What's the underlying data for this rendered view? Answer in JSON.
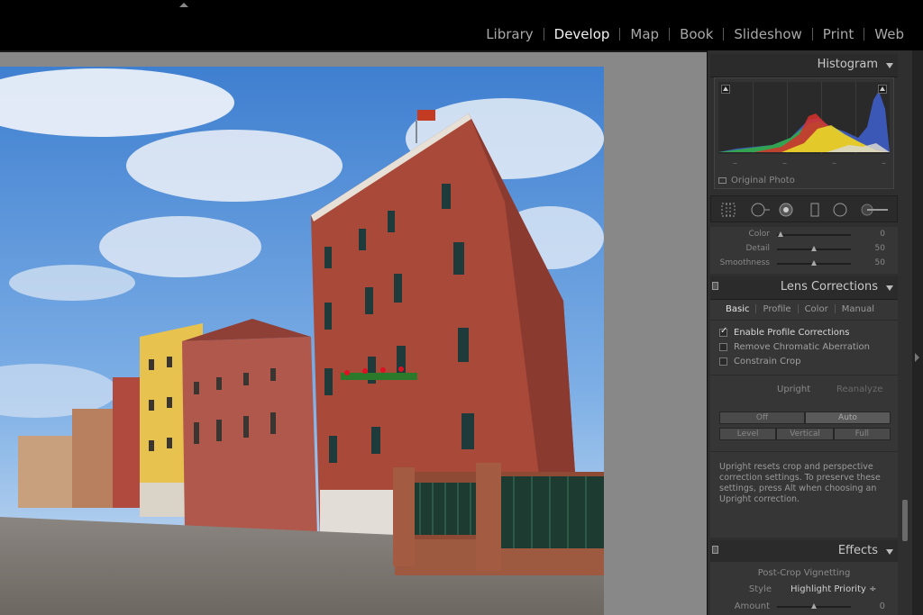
{
  "modules": [
    "Library",
    "Develop",
    "Map",
    "Book",
    "Slideshow",
    "Print",
    "Web"
  ],
  "active_module": "Develop",
  "histogram": {
    "title": "Histogram",
    "dashes": [
      "–",
      "–",
      "–",
      "–"
    ],
    "original_photo": "Original Photo"
  },
  "detail": {
    "rows": [
      {
        "label": "Color",
        "value": "0",
        "level": 0.05
      },
      {
        "label": "Detail",
        "value": "50",
        "level": 0.5
      },
      {
        "label": "Smoothness",
        "value": "50",
        "level": 0.5
      }
    ]
  },
  "lens": {
    "title": "Lens Corrections",
    "tabs": [
      "Basic",
      "Profile",
      "Color",
      "Manual"
    ],
    "active_tab": "Basic",
    "enable_profile": "Enable Profile Corrections",
    "remove_ca": "Remove Chromatic Aberration",
    "constrain_crop": "Constrain Crop",
    "upright": "Upright",
    "reanalyze": "Reanalyze",
    "seg1": [
      "Off",
      "Auto"
    ],
    "seg2": [
      "Level",
      "Vertical",
      "Full"
    ],
    "help": "Upright resets crop and perspective correction settings. To preserve these settings, press Alt when choosing an Upright correction."
  },
  "effects": {
    "title": "Effects",
    "post_crop": "Post-Crop Vignetting",
    "style_label": "Style",
    "style_value": "Highlight Priority ÷",
    "amount_label": "Amount",
    "amount_value": "0",
    "amount_level": 0.5
  },
  "colors": {
    "panel_bg": "#2f2f2f",
    "canvas_bg": "#888888",
    "active_text": "#f2f2f2"
  }
}
